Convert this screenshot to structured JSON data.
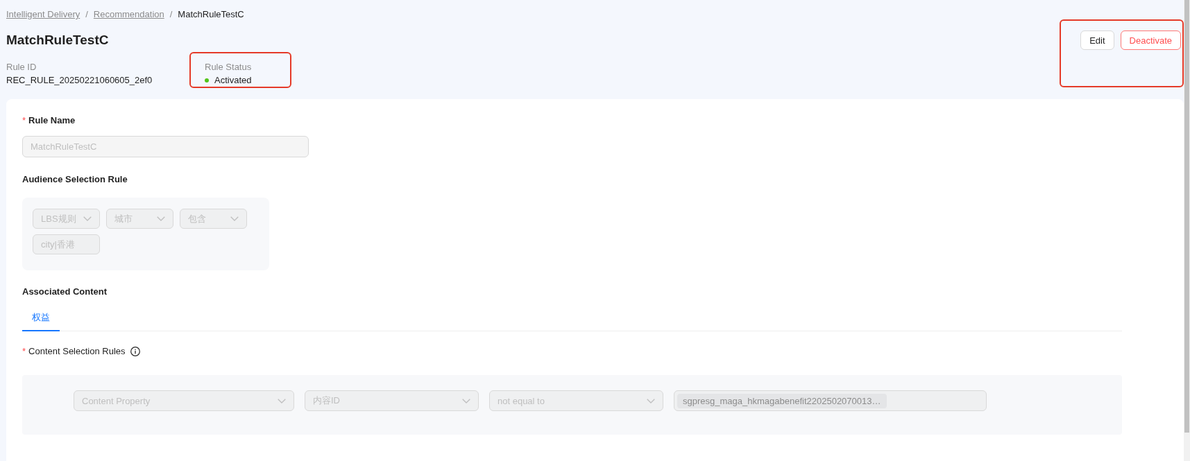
{
  "breadcrumb": [
    {
      "kind": "link",
      "label": "Intelligent Delivery"
    },
    {
      "kind": "separator",
      "label": "/"
    },
    {
      "kind": "link",
      "label": "Recommendation"
    },
    {
      "kind": "separator",
      "label": "/"
    },
    {
      "kind": "current",
      "label": "MatchRuleTestC"
    }
  ],
  "page_title": "MatchRuleTestC",
  "rule_id": {
    "label": "Rule ID",
    "value": "REC_RULE_20250221060605_2ef0"
  },
  "rule_status": {
    "label": "Rule Status",
    "value": "Activated",
    "active": true,
    "highlighted": true
  },
  "actions": {
    "highlighted": true,
    "buttons": [
      {
        "kind": "default",
        "label": "Edit"
      },
      {
        "kind": "danger",
        "label": "Deactivate"
      }
    ]
  },
  "form": {
    "disabled": true,
    "rule_name": {
      "required_mark": "*",
      "label": "Rule Name",
      "value": "MatchRuleTestC"
    },
    "audience_selection_rule": {
      "label": "Audience Selection Rule",
      "controls": [
        {
          "kind": "select",
          "value": "LBS规则"
        },
        {
          "kind": "select",
          "value": "城市"
        },
        {
          "kind": "select",
          "value": "包含"
        },
        {
          "kind": "input",
          "value": "city|香港"
        }
      ]
    },
    "associated_content": {
      "label": "Associated Content",
      "tabs": [
        {
          "label": "权益",
          "selected": true
        }
      ]
    },
    "content_selection_rules": {
      "required_mark": "*",
      "label": "Content Selection Rules",
      "controls": [
        {
          "kind": "select",
          "value": "Content Property"
        },
        {
          "kind": "select",
          "value": "内容ID"
        },
        {
          "kind": "select",
          "value": "not equal to"
        },
        {
          "kind": "tags",
          "tags": [
            "sgpresg_maga_hkmagabenefit2202502070013…"
          ]
        }
      ]
    }
  }
}
